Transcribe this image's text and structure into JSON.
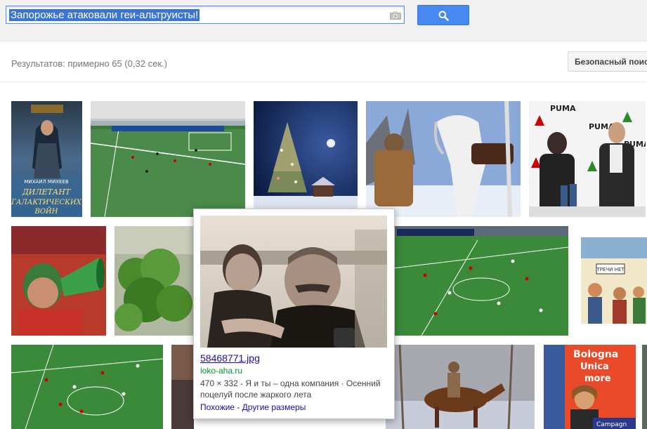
{
  "search": {
    "query": "Запорожье атаковали геи-альтруисты!"
  },
  "results": {
    "stats": "Результатов: примерно 65 (0,32 сек.)",
    "safe_search_label": "Безопасный поиск"
  },
  "thumbnails": [
    {
      "name": "book-cover",
      "text_lines": [
        "МИХАИЛ МИХЕЕВ",
        "ДИЛЕТАНТ",
        "ГАЛАКТИЧЕСКИХ",
        "ВОЙН"
      ]
    },
    {
      "name": "football-stadium",
      "text_lines": []
    },
    {
      "name": "christmas-tree",
      "text_lines": []
    },
    {
      "name": "man-with-horse",
      "text_lines": []
    },
    {
      "name": "press-conference",
      "text_lines": [
        "PUMA",
        "PUMA",
        "PUMA"
      ]
    },
    {
      "name": "fan-with-horn",
      "text_lines": []
    },
    {
      "name": "green-bush",
      "text_lines": []
    },
    {
      "name": "football-match-tv",
      "text_lines": []
    },
    {
      "name": "comic-drawing",
      "text_lines": [
        "ТРЕЧИ НЕТ"
      ]
    },
    {
      "name": "football-match-aerial",
      "text_lines": []
    },
    {
      "name": "rider-on-horse",
      "text_lines": []
    },
    {
      "name": "bologna-poster",
      "text_lines": [
        "Bologna",
        "Unica",
        "more",
        "Campagn"
      ]
    }
  ],
  "hover_card": {
    "filename": "58468771.jpg",
    "domain": "loko-aha.ru",
    "description": "470 × 332 - Я и ты – одна компания · Осенний поцелуй после жаркого лета",
    "similar_label": "Похожие",
    "separator": " - ",
    "other_sizes_label": "Другие размеры"
  },
  "colors": {
    "search_button": "#4889f1",
    "link": "#1a0dab",
    "domain_green": "#009933",
    "selection": "#3875d7"
  }
}
